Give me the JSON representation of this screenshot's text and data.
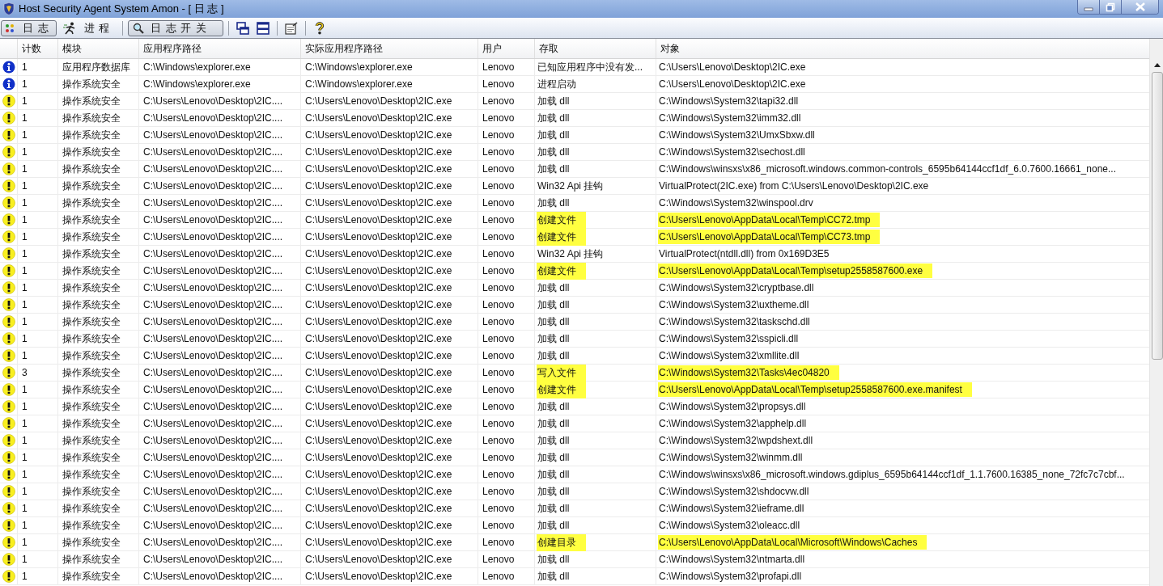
{
  "window": {
    "title": "Host Security Agent System Amon - [ 日 志 ]"
  },
  "toolbar": {
    "tabs": [
      {
        "label": "日 志",
        "selected": true
      },
      {
        "label": "进 程",
        "selected": false
      }
    ],
    "log_switch": {
      "label": "日 志 开 关"
    }
  },
  "table": {
    "columns": [
      "计数",
      "模块",
      "应用程序路径",
      "实际应用程序路径",
      "用户",
      "存取",
      "对象"
    ],
    "rows": [
      {
        "kind": "info",
        "count": "1",
        "module": "应用程序数据库",
        "path": "C:\\Windows\\explorer.exe",
        "real_path": "C:\\Windows\\explorer.exe",
        "user": "Lenovo",
        "action": "已知应用程序中没有发...",
        "object": "C:\\Users\\Lenovo\\Desktop\\2IC.exe",
        "highlighted": false
      },
      {
        "kind": "info",
        "count": "1",
        "module": "操作系统安全",
        "path": "C:\\Windows\\explorer.exe",
        "real_path": "C:\\Windows\\explorer.exe",
        "user": "Lenovo",
        "action": "进程启动",
        "object": "C:\\Users\\Lenovo\\Desktop\\2IC.exe",
        "highlighted": false
      },
      {
        "kind": "warning",
        "count": "1",
        "module": "操作系统安全",
        "path": "C:\\Users\\Lenovo\\Desktop\\2IC....",
        "real_path": "C:\\Users\\Lenovo\\Desktop\\2IC.exe",
        "user": "Lenovo",
        "action": "加载 dll",
        "object": "C:\\Windows\\System32\\tapi32.dll",
        "highlighted": false
      },
      {
        "kind": "warning",
        "count": "1",
        "module": "操作系统安全",
        "path": "C:\\Users\\Lenovo\\Desktop\\2IC....",
        "real_path": "C:\\Users\\Lenovo\\Desktop\\2IC.exe",
        "user": "Lenovo",
        "action": "加载 dll",
        "object": "C:\\Windows\\System32\\imm32.dll",
        "highlighted": false
      },
      {
        "kind": "warning",
        "count": "1",
        "module": "操作系统安全",
        "path": "C:\\Users\\Lenovo\\Desktop\\2IC....",
        "real_path": "C:\\Users\\Lenovo\\Desktop\\2IC.exe",
        "user": "Lenovo",
        "action": "加载 dll",
        "object": "C:\\Windows\\System32\\UmxSbxw.dll",
        "highlighted": false
      },
      {
        "kind": "warning",
        "count": "1",
        "module": "操作系统安全",
        "path": "C:\\Users\\Lenovo\\Desktop\\2IC....",
        "real_path": "C:\\Users\\Lenovo\\Desktop\\2IC.exe",
        "user": "Lenovo",
        "action": "加载 dll",
        "object": "C:\\Windows\\System32\\sechost.dll",
        "highlighted": false
      },
      {
        "kind": "warning",
        "count": "1",
        "module": "操作系统安全",
        "path": "C:\\Users\\Lenovo\\Desktop\\2IC....",
        "real_path": "C:\\Users\\Lenovo\\Desktop\\2IC.exe",
        "user": "Lenovo",
        "action": "加载 dll",
        "object": "C:\\Windows\\winsxs\\x86_microsoft.windows.common-controls_6595b64144ccf1df_6.0.7600.16661_none...",
        "highlighted": false
      },
      {
        "kind": "warning",
        "count": "1",
        "module": "操作系统安全",
        "path": "C:\\Users\\Lenovo\\Desktop\\2IC....",
        "real_path": "C:\\Users\\Lenovo\\Desktop\\2IC.exe",
        "user": "Lenovo",
        "action": "Win32 Api 挂钩",
        "object": "VirtualProtect(2IC.exe) from C:\\Users\\Lenovo\\Desktop\\2IC.exe",
        "highlighted": false
      },
      {
        "kind": "warning",
        "count": "1",
        "module": "操作系统安全",
        "path": "C:\\Users\\Lenovo\\Desktop\\2IC....",
        "real_path": "C:\\Users\\Lenovo\\Desktop\\2IC.exe",
        "user": "Lenovo",
        "action": "加载 dll",
        "object": "C:\\Windows\\System32\\winspool.drv",
        "highlighted": false
      },
      {
        "kind": "warning",
        "count": "1",
        "module": "操作系统安全",
        "path": "C:\\Users\\Lenovo\\Desktop\\2IC....",
        "real_path": "C:\\Users\\Lenovo\\Desktop\\2IC.exe",
        "user": "Lenovo",
        "action": "创建文件",
        "object": "C:\\Users\\Lenovo\\AppData\\Local\\Temp\\CC72.tmp",
        "highlighted": true
      },
      {
        "kind": "warning",
        "count": "1",
        "module": "操作系统安全",
        "path": "C:\\Users\\Lenovo\\Desktop\\2IC....",
        "real_path": "C:\\Users\\Lenovo\\Desktop\\2IC.exe",
        "user": "Lenovo",
        "action": "创建文件",
        "object": "C:\\Users\\Lenovo\\AppData\\Local\\Temp\\CC73.tmp",
        "highlighted": true
      },
      {
        "kind": "warning",
        "count": "1",
        "module": "操作系统安全",
        "path": "C:\\Users\\Lenovo\\Desktop\\2IC....",
        "real_path": "C:\\Users\\Lenovo\\Desktop\\2IC.exe",
        "user": "Lenovo",
        "action": "Win32 Api 挂钩",
        "object": "VirtualProtect(ntdll.dll) from 0x169D3E5",
        "highlighted": false
      },
      {
        "kind": "warning",
        "count": "1",
        "module": "操作系统安全",
        "path": "C:\\Users\\Lenovo\\Desktop\\2IC....",
        "real_path": "C:\\Users\\Lenovo\\Desktop\\2IC.exe",
        "user": "Lenovo",
        "action": "创建文件",
        "object": "C:\\Users\\Lenovo\\AppData\\Local\\Temp\\setup2558587600.exe",
        "highlighted": true
      },
      {
        "kind": "warning",
        "count": "1",
        "module": "操作系统安全",
        "path": "C:\\Users\\Lenovo\\Desktop\\2IC....",
        "real_path": "C:\\Users\\Lenovo\\Desktop\\2IC.exe",
        "user": "Lenovo",
        "action": "加载 dll",
        "object": "C:\\Windows\\System32\\cryptbase.dll",
        "highlighted": false
      },
      {
        "kind": "warning",
        "count": "1",
        "module": "操作系统安全",
        "path": "C:\\Users\\Lenovo\\Desktop\\2IC....",
        "real_path": "C:\\Users\\Lenovo\\Desktop\\2IC.exe",
        "user": "Lenovo",
        "action": "加载 dll",
        "object": "C:\\Windows\\System32\\uxtheme.dll",
        "highlighted": false
      },
      {
        "kind": "warning",
        "count": "1",
        "module": "操作系统安全",
        "path": "C:\\Users\\Lenovo\\Desktop\\2IC....",
        "real_path": "C:\\Users\\Lenovo\\Desktop\\2IC.exe",
        "user": "Lenovo",
        "action": "加载 dll",
        "object": "C:\\Windows\\System32\\taskschd.dll",
        "highlighted": false
      },
      {
        "kind": "warning",
        "count": "1",
        "module": "操作系统安全",
        "path": "C:\\Users\\Lenovo\\Desktop\\2IC....",
        "real_path": "C:\\Users\\Lenovo\\Desktop\\2IC.exe",
        "user": "Lenovo",
        "action": "加载 dll",
        "object": "C:\\Windows\\System32\\sspicli.dll",
        "highlighted": false
      },
      {
        "kind": "warning",
        "count": "1",
        "module": "操作系统安全",
        "path": "C:\\Users\\Lenovo\\Desktop\\2IC....",
        "real_path": "C:\\Users\\Lenovo\\Desktop\\2IC.exe",
        "user": "Lenovo",
        "action": "加载 dll",
        "object": "C:\\Windows\\System32\\xmllite.dll",
        "highlighted": false
      },
      {
        "kind": "warning",
        "count": "3",
        "module": "操作系统安全",
        "path": "C:\\Users\\Lenovo\\Desktop\\2IC....",
        "real_path": "C:\\Users\\Lenovo\\Desktop\\2IC.exe",
        "user": "Lenovo",
        "action": "写入文件",
        "object": "C:\\Windows\\System32\\Tasks\\4ec04820",
        "highlighted": true
      },
      {
        "kind": "warning",
        "count": "1",
        "module": "操作系统安全",
        "path": "C:\\Users\\Lenovo\\Desktop\\2IC....",
        "real_path": "C:\\Users\\Lenovo\\Desktop\\2IC.exe",
        "user": "Lenovo",
        "action": "创建文件",
        "object": "C:\\Users\\Lenovo\\AppData\\Local\\Temp\\setup2558587600.exe.manifest",
        "highlighted": true
      },
      {
        "kind": "warning",
        "count": "1",
        "module": "操作系统安全",
        "path": "C:\\Users\\Lenovo\\Desktop\\2IC....",
        "real_path": "C:\\Users\\Lenovo\\Desktop\\2IC.exe",
        "user": "Lenovo",
        "action": "加载 dll",
        "object": "C:\\Windows\\System32\\propsys.dll",
        "highlighted": false
      },
      {
        "kind": "warning",
        "count": "1",
        "module": "操作系统安全",
        "path": "C:\\Users\\Lenovo\\Desktop\\2IC....",
        "real_path": "C:\\Users\\Lenovo\\Desktop\\2IC.exe",
        "user": "Lenovo",
        "action": "加载 dll",
        "object": "C:\\Windows\\System32\\apphelp.dll",
        "highlighted": false
      },
      {
        "kind": "warning",
        "count": "1",
        "module": "操作系统安全",
        "path": "C:\\Users\\Lenovo\\Desktop\\2IC....",
        "real_path": "C:\\Users\\Lenovo\\Desktop\\2IC.exe",
        "user": "Lenovo",
        "action": "加载 dll",
        "object": "C:\\Windows\\System32\\wpdshext.dll",
        "highlighted": false
      },
      {
        "kind": "warning",
        "count": "1",
        "module": "操作系统安全",
        "path": "C:\\Users\\Lenovo\\Desktop\\2IC....",
        "real_path": "C:\\Users\\Lenovo\\Desktop\\2IC.exe",
        "user": "Lenovo",
        "action": "加载 dll",
        "object": "C:\\Windows\\System32\\winmm.dll",
        "highlighted": false
      },
      {
        "kind": "warning",
        "count": "1",
        "module": "操作系统安全",
        "path": "C:\\Users\\Lenovo\\Desktop\\2IC....",
        "real_path": "C:\\Users\\Lenovo\\Desktop\\2IC.exe",
        "user": "Lenovo",
        "action": "加载 dll",
        "object": "C:\\Windows\\winsxs\\x86_microsoft.windows.gdiplus_6595b64144ccf1df_1.1.7600.16385_none_72fc7c7cbf...",
        "highlighted": false
      },
      {
        "kind": "warning",
        "count": "1",
        "module": "操作系统安全",
        "path": "C:\\Users\\Lenovo\\Desktop\\2IC....",
        "real_path": "C:\\Users\\Lenovo\\Desktop\\2IC.exe",
        "user": "Lenovo",
        "action": "加载 dll",
        "object": "C:\\Windows\\System32\\shdocvw.dll",
        "highlighted": false
      },
      {
        "kind": "warning",
        "count": "1",
        "module": "操作系统安全",
        "path": "C:\\Users\\Lenovo\\Desktop\\2IC....",
        "real_path": "C:\\Users\\Lenovo\\Desktop\\2IC.exe",
        "user": "Lenovo",
        "action": "加载 dll",
        "object": "C:\\Windows\\System32\\ieframe.dll",
        "highlighted": false
      },
      {
        "kind": "warning",
        "count": "1",
        "module": "操作系统安全",
        "path": "C:\\Users\\Lenovo\\Desktop\\2IC....",
        "real_path": "C:\\Users\\Lenovo\\Desktop\\2IC.exe",
        "user": "Lenovo",
        "action": "加载 dll",
        "object": "C:\\Windows\\System32\\oleacc.dll",
        "highlighted": false
      },
      {
        "kind": "warning",
        "count": "1",
        "module": "操作系统安全",
        "path": "C:\\Users\\Lenovo\\Desktop\\2IC....",
        "real_path": "C:\\Users\\Lenovo\\Desktop\\2IC.exe",
        "user": "Lenovo",
        "action": "创建目录",
        "object": "C:\\Users\\Lenovo\\AppData\\Local\\Microsoft\\Windows\\Caches",
        "highlighted": true
      },
      {
        "kind": "warning",
        "count": "1",
        "module": "操作系统安全",
        "path": "C:\\Users\\Lenovo\\Desktop\\2IC....",
        "real_path": "C:\\Users\\Lenovo\\Desktop\\2IC.exe",
        "user": "Lenovo",
        "action": "加载 dll",
        "object": "C:\\Windows\\System32\\ntmarta.dll",
        "highlighted": false
      },
      {
        "kind": "warning",
        "count": "1",
        "module": "操作系统安全",
        "path": "C:\\Users\\Lenovo\\Desktop\\2IC....",
        "real_path": "C:\\Users\\Lenovo\\Desktop\\2IC.exe",
        "user": "Lenovo",
        "action": "加载 dll",
        "object": "C:\\Windows\\System32\\profapi.dll",
        "highlighted": false
      }
    ]
  }
}
